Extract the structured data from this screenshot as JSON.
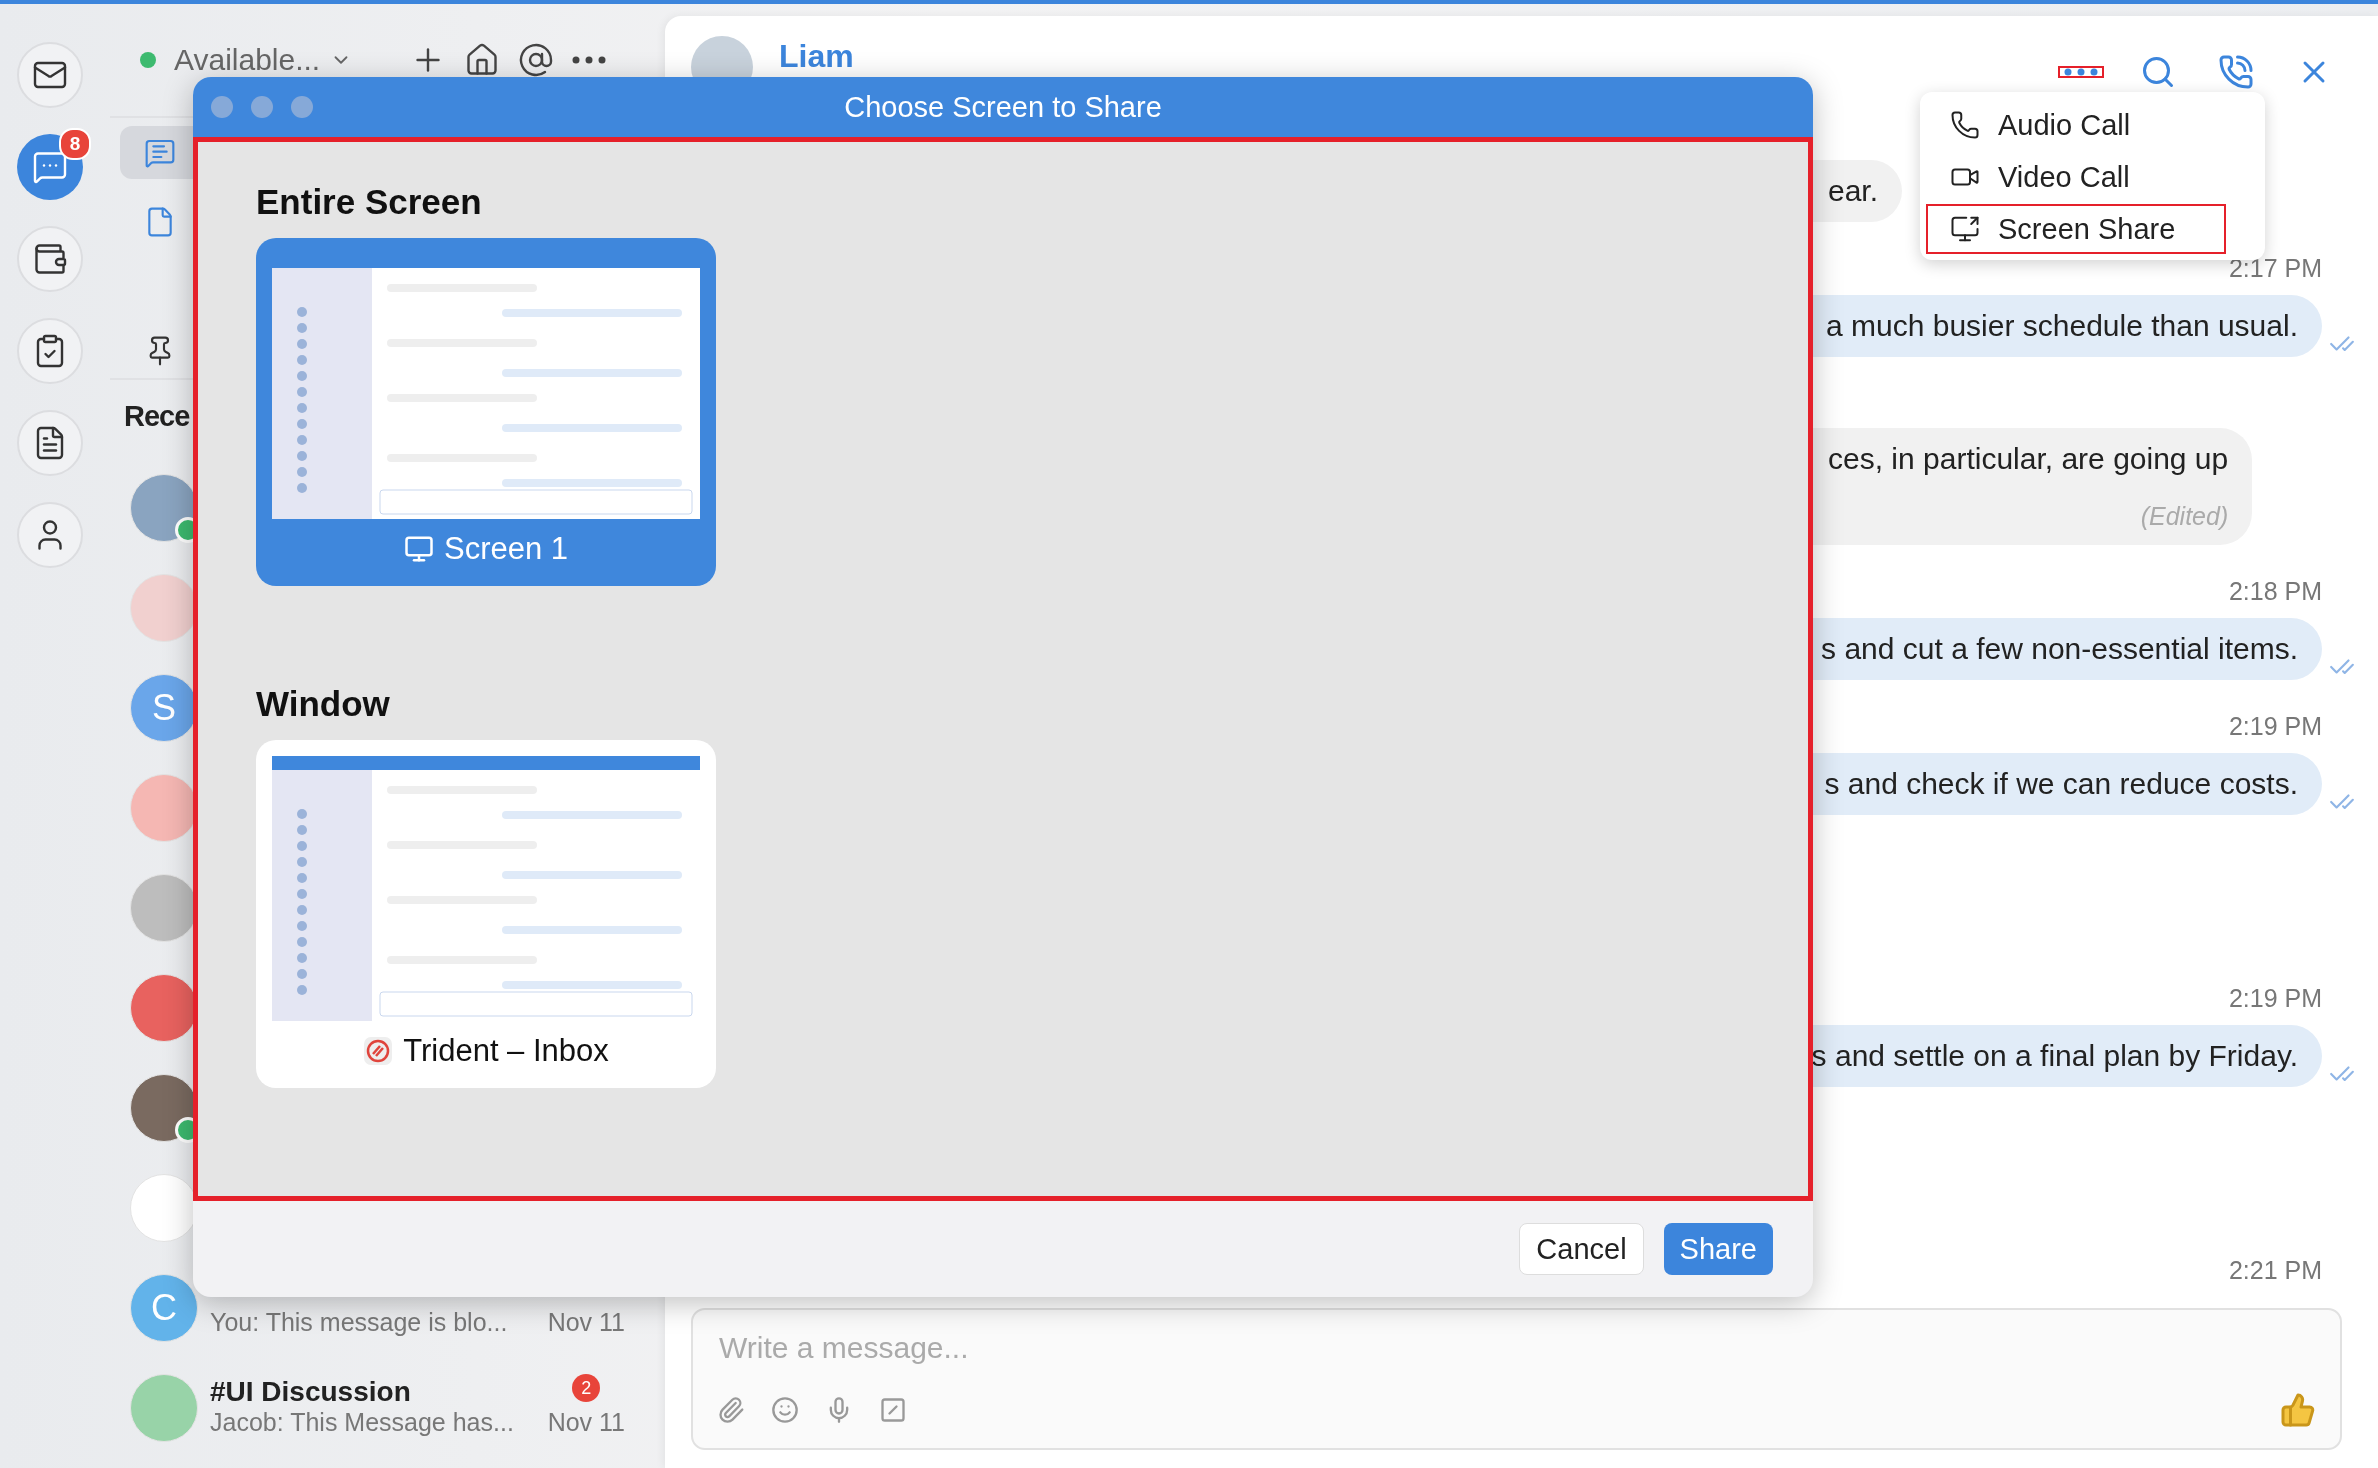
{
  "rail": [
    {
      "kind": "mail",
      "selected": false
    },
    {
      "kind": "chat",
      "selected": true,
      "badge": "8"
    },
    {
      "kind": "wallet",
      "selected": false
    },
    {
      "kind": "tasks",
      "selected": false
    },
    {
      "kind": "notes",
      "selected": false
    },
    {
      "kind": "contacts",
      "selected": false
    }
  ],
  "status": {
    "label": "Available...",
    "color": "#3dba6f"
  },
  "nav": [
    {
      "kind": "chats",
      "selected": true
    },
    {
      "kind": "files",
      "selected": false
    },
    {
      "kind": "pin",
      "selected": false
    }
  ],
  "recent_heading": "Rece",
  "chats": [
    {
      "kind": "photo",
      "color": "#8aa4c0",
      "online": true
    },
    {
      "kind": "photo",
      "color": "#f1d0cf",
      "online": false
    },
    {
      "kind": "letter",
      "letter": "S",
      "color": "#6aa6ea",
      "online": false
    },
    {
      "kind": "photo",
      "color": "#f5b7b3",
      "online": false
    },
    {
      "kind": "photo",
      "color": "#bdbdbd",
      "online": false
    },
    {
      "kind": "photo",
      "color": "#e8625f",
      "online": false
    },
    {
      "kind": "photo",
      "color": "#7a6a60",
      "online": true
    },
    {
      "kind": "photo",
      "color": "#ffffff",
      "online": false
    },
    {
      "kind": "letter",
      "letter": "C",
      "color": "#62b3ea",
      "online": false,
      "preview": "You: This message is blo...",
      "time": "Nov 11"
    },
    {
      "kind": "photo",
      "color": "#98d3a8",
      "online": false,
      "name": "#UI Discussion",
      "badge": "2",
      "preview": "Jacob: This Message has...",
      "time": "Nov 11"
    }
  ],
  "chat": {
    "contact": "Liam",
    "header_actions": [
      {
        "kind": "more",
        "highlighted": true
      },
      {
        "kind": "search",
        "highlighted": false
      },
      {
        "kind": "call",
        "highlighted": false
      },
      {
        "kind": "close",
        "highlighted": false
      }
    ],
    "messages": [
      {
        "kind": "incoming",
        "text": "ear."
      },
      {
        "kind": "time",
        "text": "2:17 PM"
      },
      {
        "kind": "outgoing",
        "text": "a much busier schedule than usual."
      },
      {
        "kind": "incoming",
        "text": "ces, in particular, are going up",
        "note": "(Edited)"
      },
      {
        "kind": "time",
        "text": "2:18 PM"
      },
      {
        "kind": "outgoing",
        "text": "s and cut a few non-essential items."
      },
      {
        "kind": "time",
        "text": "2:19 PM"
      },
      {
        "kind": "outgoing",
        "text": "s and check if we can reduce costs."
      },
      {
        "kind": "time",
        "text": "2:19 PM"
      },
      {
        "kind": "outgoing",
        "text": "s and settle on a final plan by Friday."
      },
      {
        "kind": "time",
        "text": "2:21 PM"
      }
    ],
    "composer": {
      "placeholder": "Write a message..."
    }
  },
  "menu": [
    {
      "kind": "audio",
      "label": "Audio Call",
      "highlighted": false
    },
    {
      "kind": "video",
      "label": "Video Call",
      "highlighted": false
    },
    {
      "kind": "screen",
      "label": "Screen Share",
      "highlighted": true
    }
  ],
  "dialog": {
    "title": "Choose Screen to Share",
    "highlighted": true,
    "sections": [
      {
        "title": "Entire Screen",
        "sources": [
          {
            "kind": "screen",
            "label": "Screen 1",
            "selected": true
          }
        ]
      },
      {
        "title": "Window",
        "sources": [
          {
            "kind": "window",
            "label": "Trident – Inbox",
            "selected": false
          }
        ]
      }
    ],
    "buttons": [
      {
        "label": "Cancel",
        "primary": false
      },
      {
        "label": "Share",
        "primary": true
      }
    ]
  }
}
